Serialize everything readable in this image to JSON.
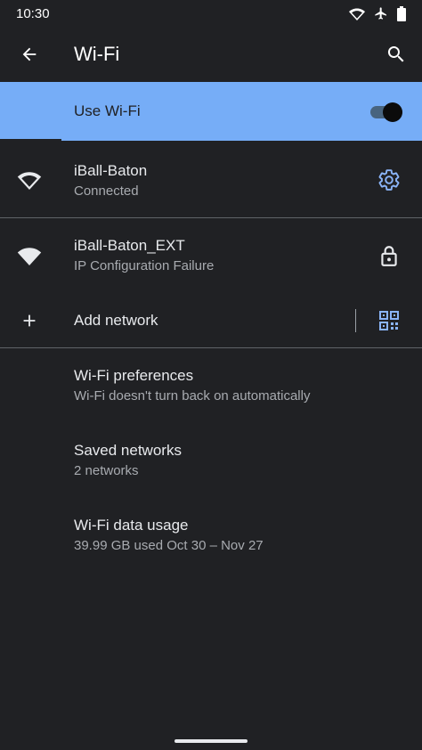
{
  "status_bar": {
    "time": "10:30",
    "icons": [
      "wifi-icon",
      "airplane-icon",
      "battery-icon"
    ]
  },
  "app_bar": {
    "back_icon": "arrow-back-icon",
    "title": "Wi-Fi",
    "search_icon": "search-icon"
  },
  "master_switch": {
    "label": "Use Wi-Fi",
    "state": "on"
  },
  "networks": [
    {
      "name": "iBall-Baton",
      "status": "Connected",
      "signal_icon": "wifi-signal-icon",
      "action_icon": "gear-icon"
    },
    {
      "name": "iBall-Baton_EXT",
      "status": "IP Configuration Failure",
      "signal_icon": "wifi-signal-icon",
      "action_icon": "lock-icon"
    }
  ],
  "add_network": {
    "label": "Add network",
    "icon": "plus-icon",
    "qr_icon": "qr-code-scan-icon"
  },
  "preferences": [
    {
      "title": "Wi-Fi preferences",
      "summary": "Wi-Fi doesn't turn back on automatically"
    },
    {
      "title": "Saved networks",
      "summary": "2 networks"
    },
    {
      "title": "Wi-Fi data usage",
      "summary": "39.99 GB used Oct 30 – Nov 27"
    }
  ],
  "colors": {
    "background": "#202124",
    "accent": "#76adf7",
    "icon_accent": "#8ab4f8",
    "text_primary": "#e8eaed",
    "text_secondary": "#a8abb0"
  }
}
